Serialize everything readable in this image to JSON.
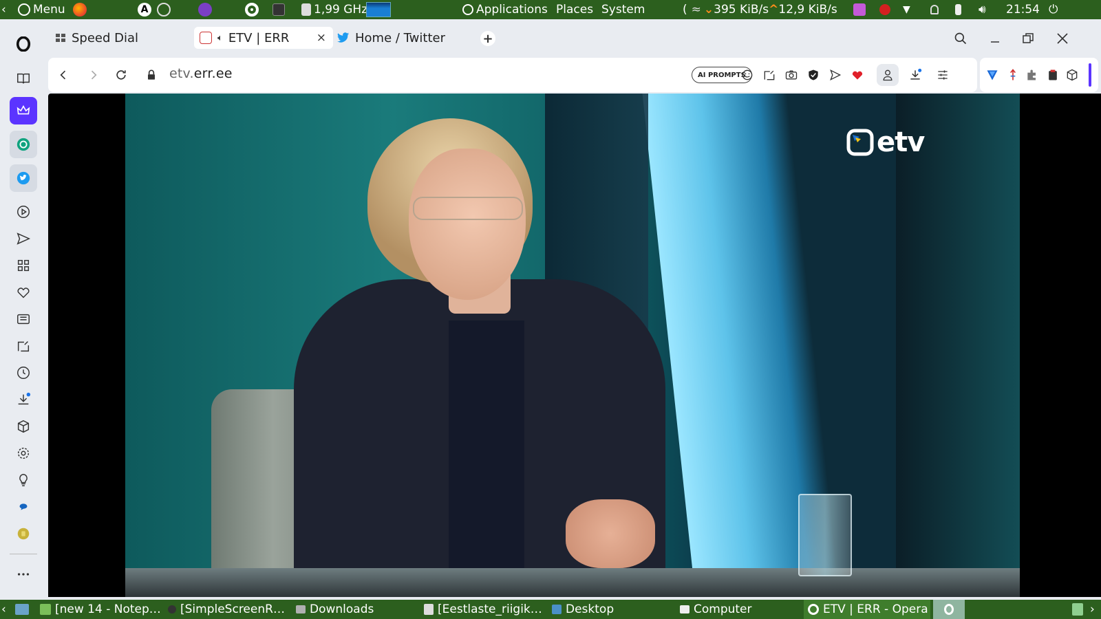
{
  "top_panel": {
    "menu_label": "Menu",
    "cpu_freq": "1,99 GHz",
    "applications_label": "Applications",
    "places_label": "Places",
    "system_label": "System",
    "net_down": "395 KiB/s",
    "net_up": "12,9 KiB/s",
    "clock": "21:54"
  },
  "tabs": [
    {
      "label": "Speed Dial",
      "icon": "speed-dial-icon"
    },
    {
      "label": "ETV | ERR",
      "icon": "err-icon",
      "active": true,
      "audio": true,
      "close": "×"
    },
    {
      "label": "Home / Twitter",
      "icon": "twitter-icon"
    }
  ],
  "new_tab_label": "+",
  "address": {
    "url_host": "etv.",
    "url_domain": "err.ee",
    "ai_prompts_label": "AI PROMPTS"
  },
  "video": {
    "channel_logo_text": "etv"
  },
  "sidebar": {
    "items": [
      "opera-logo",
      "bookmarks",
      "opera-premium",
      "chatgpt",
      "twitter",
      "player",
      "send",
      "speed-dial",
      "heart",
      "news",
      "pinboard",
      "history",
      "downloads",
      "extensions",
      "settings",
      "tips",
      "messenger",
      "wallet",
      "more"
    ]
  },
  "taskbar": {
    "items": [
      {
        "label": "[new 14 - Notep…"
      },
      {
        "label": "[SimpleScreenR…"
      },
      {
        "label": "Downloads"
      },
      {
        "label": "[Eestlaste_riigik…"
      },
      {
        "label": "Desktop"
      },
      {
        "label": "Computer"
      },
      {
        "label": "ETV | ERR - Opera",
        "active": true
      }
    ]
  },
  "colors": {
    "panel_bg": "#2c5f1e",
    "sidebar_bg": "#e9ecf1",
    "premium_accent": "#5b34ff",
    "twitter_blue": "#1d9bf0"
  }
}
